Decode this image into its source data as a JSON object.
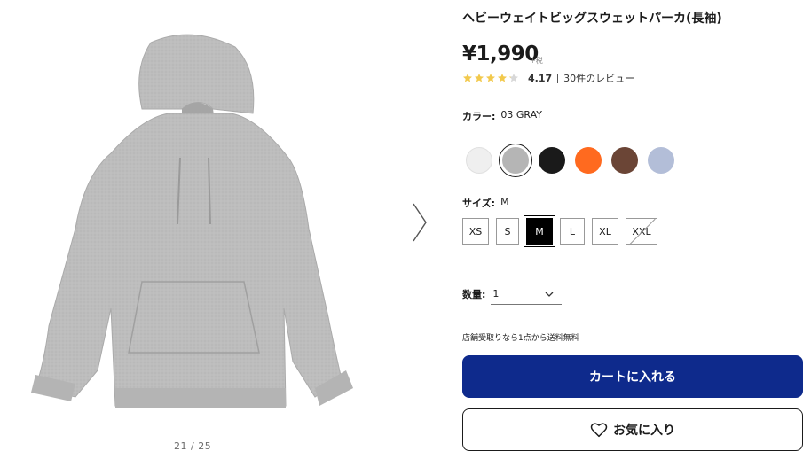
{
  "product": {
    "title": "ヘビーウェイトビッグスウェットパーカ(長袖)",
    "price": "¥1,990",
    "tax_note": "+税",
    "rating": {
      "stars": 4.17,
      "score": "4.17",
      "reviews": "30件のレビュー"
    }
  },
  "color": {
    "label": "カラー:",
    "value": "03 GRAY",
    "swatches": [
      {
        "name": "off-white",
        "hex": "#efefef"
      },
      {
        "name": "gray",
        "hex": "#b5b5b5",
        "selected": true
      },
      {
        "name": "black",
        "hex": "#1a1a1a"
      },
      {
        "name": "orange",
        "hex": "#ff6a1f"
      },
      {
        "name": "brown",
        "hex": "#6b4536"
      },
      {
        "name": "blue",
        "hex": "#b3bed8"
      }
    ]
  },
  "size": {
    "label": "サイズ:",
    "value": "M",
    "options": [
      "XS",
      "S",
      "M",
      "L",
      "XL",
      "XXL"
    ],
    "selected": "M",
    "sold_out": [
      "XXL"
    ]
  },
  "quantity": {
    "label": "数量:",
    "value": "1"
  },
  "notice": "店舗受取りなら1点から送料無料",
  "buttons": {
    "cart": "カートに入れる",
    "favorite": "お気に入り"
  },
  "gallery": {
    "pager": "21 / 25"
  },
  "colors": {
    "primary": "#0e2a8c",
    "star": "#f2c94c",
    "star_empty": "#d8d8d8"
  }
}
